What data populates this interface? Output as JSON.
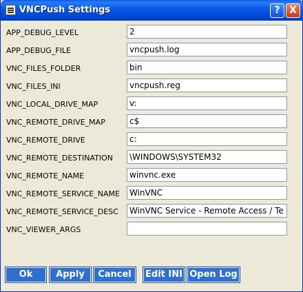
{
  "window": {
    "title": "VNCPush Settings"
  },
  "titlebar_buttons": {
    "help": "?",
    "close": "X"
  },
  "fields": [
    {
      "label": "APP_DEBUG_LEVEL",
      "value": "2"
    },
    {
      "label": "APP_DEBUG_FILE",
      "value": "vncpush.log"
    },
    {
      "label": "VNC_FILES_FOLDER",
      "value": "bin"
    },
    {
      "label": "VNC_FILES_INI",
      "value": "vncpush.reg"
    },
    {
      "label": "VNC_LOCAL_DRIVE_MAP",
      "value": "v:"
    },
    {
      "label": "VNC_REMOTE_DRIVE_MAP",
      "value": "c$"
    },
    {
      "label": "VNC_REMOTE_DRIVE",
      "value": "c:"
    },
    {
      "label": "VNC_REMOTE_DESTINATION",
      "value": "\\WINDOWS\\SYSTEM32"
    },
    {
      "label": "VNC_REMOTE_NAME",
      "value": "winvnc.exe"
    },
    {
      "label": "VNC_REMOTE_SERVICE_NAME",
      "value": "WinVNC"
    },
    {
      "label": "VNC_REMOTE_SERVICE_DESC",
      "value": "WinVNC Service - Remote Access / Te"
    },
    {
      "label": "VNC_VIEWER_ARGS",
      "value": ""
    }
  ],
  "buttons": {
    "ok": "Ok",
    "apply": "Apply",
    "cancel": "Cancel",
    "edit_ini": "Edit INI",
    "open_log": "Open Log"
  }
}
